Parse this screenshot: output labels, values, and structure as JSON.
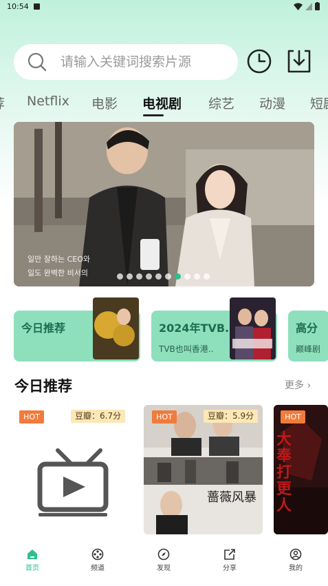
{
  "status_bar": {
    "time": "10:54"
  },
  "search": {
    "placeholder": "请输入关键词搜索片源"
  },
  "tabs": [
    {
      "label": "荐"
    },
    {
      "label": "Netflix"
    },
    {
      "label": "电影"
    },
    {
      "label": "电视剧"
    },
    {
      "label": "综艺"
    },
    {
      "label": "动漫"
    },
    {
      "label": "短剧"
    }
  ],
  "banner": {
    "caption_line1": "일만 잘하는 CEO와",
    "caption_line2": "일도 완벽한 비서의",
    "dots_total": 10,
    "active_dot": 7
  },
  "recommend_cards": [
    {
      "title": "今日推荐",
      "subtitle": ""
    },
    {
      "title": "2024年TVB..",
      "subtitle": "TVB也叫香港.."
    },
    {
      "title": "高分",
      "subtitle": "巅峰剧"
    }
  ],
  "section": {
    "title": "今日推荐",
    "more": "更多"
  },
  "content_cards": [
    {
      "hot": "HOT",
      "score": "豆瓣：6.7分"
    },
    {
      "hot": "HOT",
      "score": "豆瓣：5.9分",
      "poster_text": "蔷薇风暴"
    },
    {
      "hot": "HOT",
      "poster_text": "大奉打更人"
    }
  ],
  "bottom_nav": [
    {
      "label": "首页",
      "icon": "home-icon"
    },
    {
      "label": "频道",
      "icon": "channel-icon"
    },
    {
      "label": "发现",
      "icon": "compass-icon"
    },
    {
      "label": "分享",
      "icon": "share-icon"
    },
    {
      "label": "我的",
      "icon": "profile-icon"
    }
  ],
  "colors": {
    "accent": "#2fbf8e",
    "card_bg": "#8ee0bd",
    "hot": "#f07b3b",
    "score_bg": "#fde7b6"
  }
}
